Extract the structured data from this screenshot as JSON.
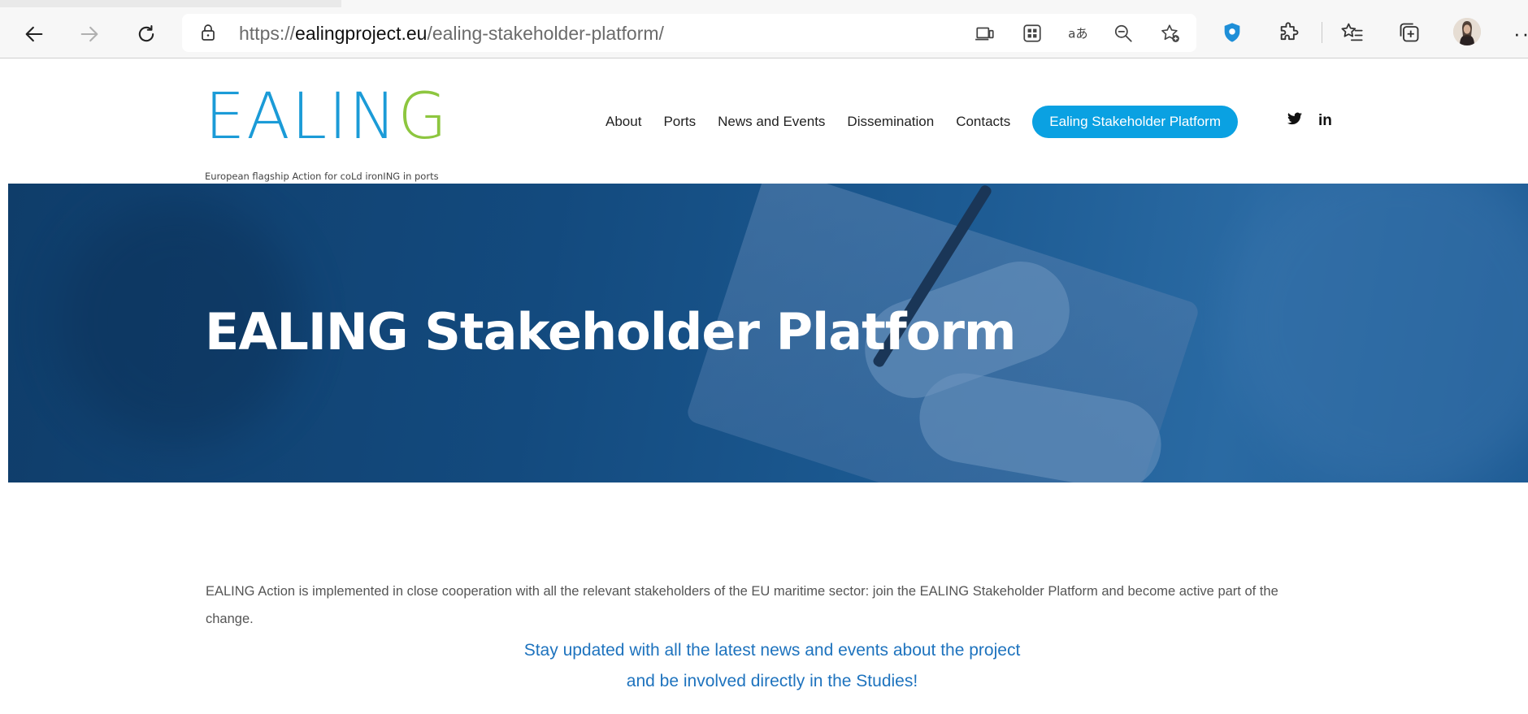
{
  "browser": {
    "url_scheme": "https://",
    "url_domain": "ealingproject.eu",
    "url_path": "/ealing-stakeholder-platform/",
    "icons": {
      "back": "arrow-left-icon",
      "forward": "arrow-right-icon",
      "refresh": "refresh-icon",
      "lock": "lock-icon",
      "app_available": "app-available-icon",
      "qr": "qr-code-icon",
      "read_aloud": "translate-icon",
      "zoom": "zoom-out-icon",
      "favorite": "add-favorite-icon",
      "shield": "shield-icon",
      "extensions": "puzzle-icon",
      "favorites": "favorites-icon",
      "collections": "collections-icon",
      "more": "more-icon"
    },
    "more_label": "···"
  },
  "site": {
    "logo_word": "EALIN",
    "logo_word_end": "G",
    "logo_tagline": "European flagship Action for coLd ironING in ports",
    "nav": [
      {
        "label": "About"
      },
      {
        "label": "Ports"
      },
      {
        "label": "News and Events"
      },
      {
        "label": "Dissemination"
      },
      {
        "label": "Contacts"
      }
    ],
    "cta_label": "Ealing Stakeholder Platform",
    "social": {
      "twitter": "twitter-icon",
      "linkedin": "linkedin-icon",
      "twitter_glyph": "🐦",
      "linkedin_glyph": "in"
    }
  },
  "hero": {
    "title": "EALING Stakeholder Platform"
  },
  "content": {
    "intro": "EALING Action is implemented in close cooperation with all the relevant stakeholders of the EU maritime sector: join the EALING Stakeholder Platform and become active part of the change.",
    "callout_line1": "Stay updated with all the latest news and events about the project",
    "callout_line2": "and be involved directly in the Studies!"
  },
  "colors": {
    "brand_blue": "#0aa1e2",
    "logo_green": "#8dc63f",
    "callout_blue": "#1e73be",
    "hero_blue": "#134a7e"
  }
}
